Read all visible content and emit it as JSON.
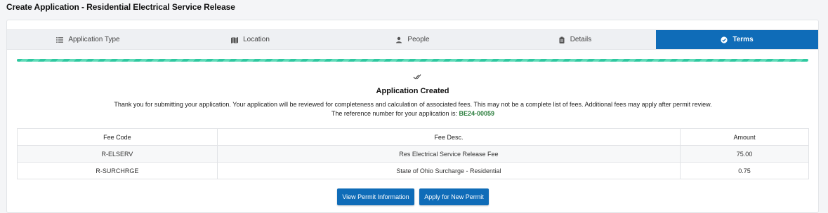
{
  "page": {
    "title": "Create Application - Residential Electrical Service Release"
  },
  "tabs": [
    {
      "label": "Application Type",
      "icon": "list-icon",
      "active": false
    },
    {
      "label": "Location",
      "icon": "map-icon",
      "active": false
    },
    {
      "label": "People",
      "icon": "person-icon",
      "active": false
    },
    {
      "label": "Details",
      "icon": "clipboard-icon",
      "active": false
    },
    {
      "label": "Terms",
      "icon": "check-circle-icon",
      "active": true
    }
  ],
  "progress": {
    "percent": 100,
    "color": "#2fc8a0"
  },
  "confirmation": {
    "title": "Application Created",
    "message": "Thank you for submitting your application. Your application will be reviewed for completeness and calculation of associated fees. This may not be a complete list of fees. Additional fees may apply after permit review. The reference number for your application is: ",
    "reference_number": "BE24-00059"
  },
  "fees_table": {
    "headers": [
      "Fee Code",
      "Fee Desc.",
      "Amount"
    ],
    "rows": [
      [
        "R-ELSERV",
        "Res Electrical Service Release Fee",
        "75.00"
      ],
      [
        "R-SURCHRGE",
        "State of Ohio Surcharge - Residential",
        "0.75"
      ]
    ]
  },
  "buttons": {
    "view_permit": "View Permit Information",
    "apply_new": "Apply for New Permit"
  },
  "colors": {
    "accent": "#0f6cb8",
    "reference": "#2a7d3c"
  }
}
